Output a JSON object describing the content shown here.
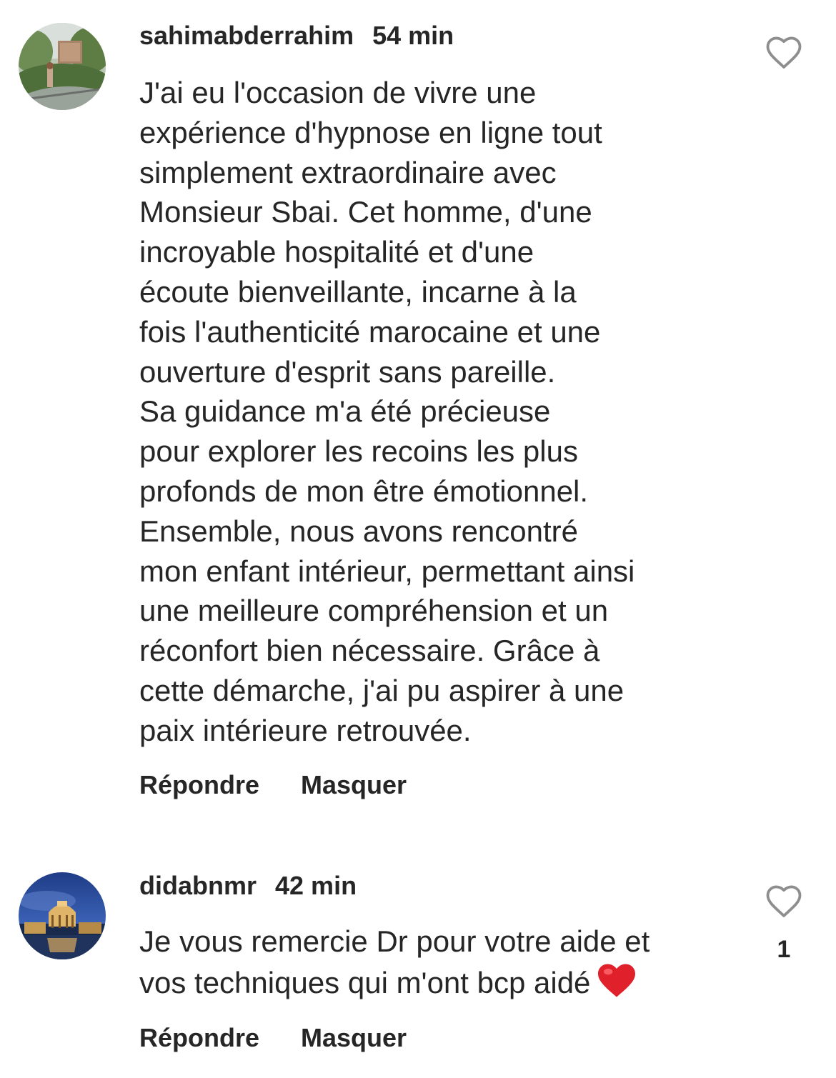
{
  "comments": [
    {
      "username": "sahimabderrahim",
      "time": "54 min",
      "text": "J'ai eu l'occasion de vivre une\nexpérience d'hypnose en ligne tout\nsimplement extraordinaire avec\nMonsieur Sbai. Cet homme, d'une\nincroyable hospitalité et d'une\nécoute bienveillante, incarne à la\nfois l'authenticité marocaine et une\nouverture d'esprit sans pareille.\nSa guidance m'a été précieuse\npour explorer les recoins les plus\nprofonds de mon être émotionnel.\nEnsemble, nous avons rencontré\nmon enfant intérieur, permettant ainsi\nune meilleure compréhension et un\nréconfort bien nécessaire. Grâce à\ncette démarche, j'ai pu aspirer à une\npaix intérieure retrouvée.",
      "reply_label": "Répondre",
      "hide_label": "Masquer",
      "like_count": "",
      "avatar_icon": "garden-photo-avatar"
    },
    {
      "username": "didabnmr",
      "time": "42 min",
      "text": "Je vous remercie Dr pour votre aide et\nvos techniques qui m'ont bcp aidé",
      "reply_label": "Répondre",
      "hide_label": "Masquer",
      "like_count": "1",
      "avatar_icon": "palace-night-avatar",
      "emoji": "red-heart-emoji"
    }
  ],
  "colors": {
    "text": "#262626",
    "heart_emoji": "#e0202a",
    "like_outline": "#8e8e8e"
  }
}
